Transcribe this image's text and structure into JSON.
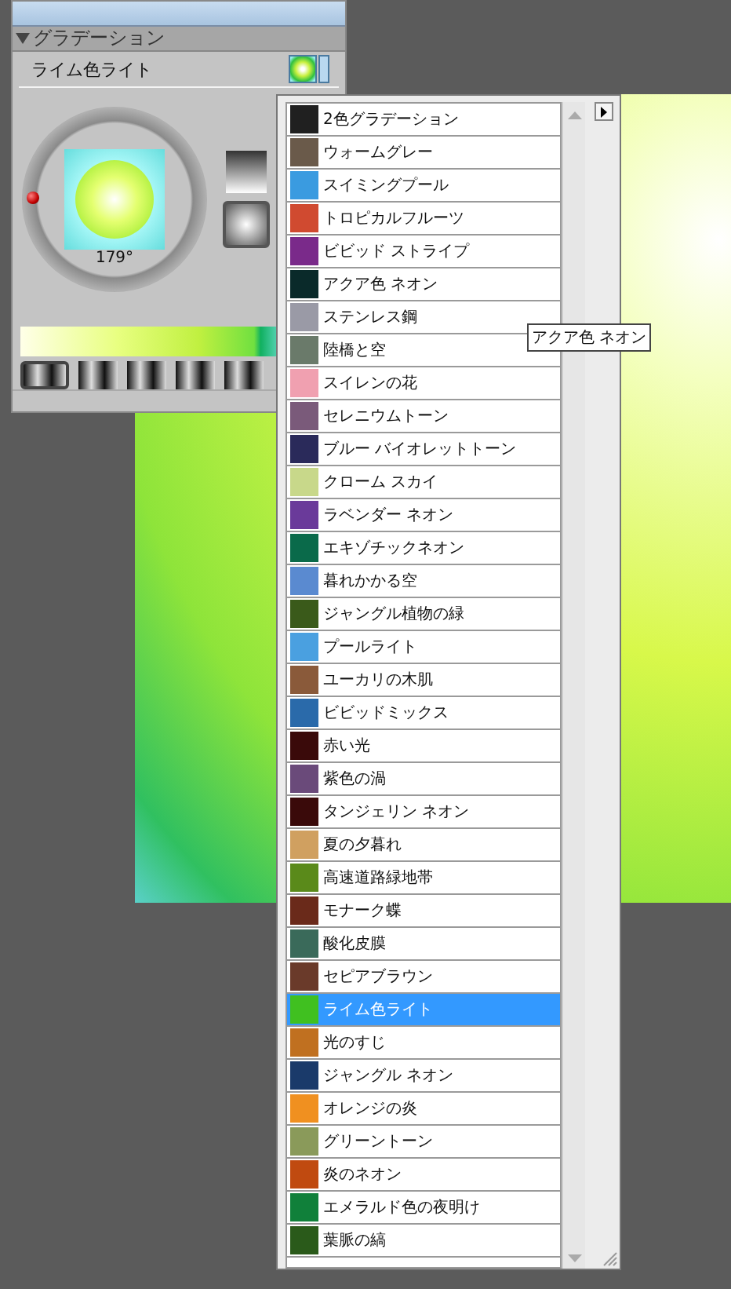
{
  "panel": {
    "title": "グラデーション",
    "expanded": true,
    "preset_name": "ライム色ライト",
    "angle": "179°"
  },
  "presets": [
    {
      "selected": true
    },
    {
      "selected": false
    },
    {
      "selected": false
    },
    {
      "selected": false
    },
    {
      "selected": false
    }
  ],
  "dropdown": {
    "items": [
      {
        "label": "2色グラデーション",
        "color": "#202020",
        "selected": false
      },
      {
        "label": "ウォームグレー",
        "color": "#6a5a4a",
        "selected": false
      },
      {
        "label": "スイミングプール",
        "color": "#3a9be0",
        "selected": false
      },
      {
        "label": "トロピカルフルーツ",
        "color": "#d04a30",
        "selected": false
      },
      {
        "label": "ビビッド ストライプ",
        "color": "#7a2a8a",
        "selected": false
      },
      {
        "label": "アクア色 ネオン",
        "color": "#0a2a2a",
        "selected": false
      },
      {
        "label": "ステンレス鋼",
        "color": "#9a9aa6",
        "selected": false
      },
      {
        "label": "陸橋と空",
        "color": "#6a7a6a",
        "selected": false
      },
      {
        "label": "スイレンの花",
        "color": "#f0a0b0",
        "selected": false
      },
      {
        "label": "セレニウムトーン",
        "color": "#7a5a7a",
        "selected": false
      },
      {
        "label": "ブルー バイオレットトーン",
        "color": "#2a2a5a",
        "selected": false
      },
      {
        "label": "クローム スカイ",
        "color": "#c8d88a",
        "selected": false
      },
      {
        "label": "ラベンダー ネオン",
        "color": "#6a3a9a",
        "selected": false
      },
      {
        "label": "エキゾチックネオン",
        "color": "#0a6a4a",
        "selected": false
      },
      {
        "label": "暮れかかる空",
        "color": "#5a8ad0",
        "selected": false
      },
      {
        "label": "ジャングル植物の緑",
        "color": "#3a5a1a",
        "selected": false
      },
      {
        "label": "プールライト",
        "color": "#4aa0e0",
        "selected": false
      },
      {
        "label": "ユーカリの木肌",
        "color": "#8a5a3a",
        "selected": false
      },
      {
        "label": "ビビッドミックス",
        "color": "#2a6aaa",
        "selected": false
      },
      {
        "label": "赤い光",
        "color": "#3a0a0a",
        "selected": false
      },
      {
        "label": "紫色の渦",
        "color": "#6a4a7a",
        "selected": false
      },
      {
        "label": "タンジェリン ネオン",
        "color": "#3a0a0a",
        "selected": false
      },
      {
        "label": "夏の夕暮れ",
        "color": "#d0a060",
        "selected": false
      },
      {
        "label": "高速道路緑地帯",
        "color": "#5a8a1a",
        "selected": false
      },
      {
        "label": "モナーク蝶",
        "color": "#6a2a1a",
        "selected": false
      },
      {
        "label": "酸化皮膜",
        "color": "#3a6a5a",
        "selected": false
      },
      {
        "label": "セピアブラウン",
        "color": "#6a3a2a",
        "selected": false
      },
      {
        "label": "ライム色ライト",
        "color": "#40c020",
        "selected": true
      },
      {
        "label": "光のすじ",
        "color": "#c07020",
        "selected": false
      },
      {
        "label": "ジャングル ネオン",
        "color": "#1a3a6a",
        "selected": false
      },
      {
        "label": "オレンジの炎",
        "color": "#f09020",
        "selected": false
      },
      {
        "label": "グリーントーン",
        "color": "#8a9a5a",
        "selected": false
      },
      {
        "label": "炎のネオン",
        "color": "#c04a10",
        "selected": false
      },
      {
        "label": "エメラルド色の夜明け",
        "color": "#10803a",
        "selected": false
      },
      {
        "label": "葉脈の縞",
        "color": "#2a5a1a",
        "selected": false
      }
    ]
  },
  "tooltip": {
    "text": "アクア色 ネオン"
  }
}
